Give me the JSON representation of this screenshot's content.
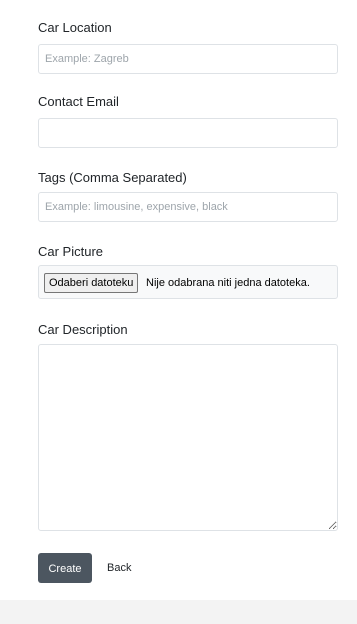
{
  "form": {
    "location": {
      "label": "Car Location",
      "value": "",
      "placeholder": "Example: Zagreb"
    },
    "email": {
      "label": "Contact Email",
      "value": "",
      "placeholder": ""
    },
    "tags": {
      "label": "Tags (Comma Separated)",
      "value": "",
      "placeholder": "Example: limousine, expensive, black"
    },
    "picture": {
      "label": "Car Picture",
      "button_label": "Odaberi datoteku",
      "status": "Nije odabrana niti jedna datoteka."
    },
    "description": {
      "label": "Car Description",
      "value": ""
    }
  },
  "actions": {
    "create_label": "Create",
    "back_label": "Back"
  },
  "colors": {
    "page_background": "#f3f3f3",
    "card_background": "#ffffff",
    "primary_button": "#4c5660",
    "input_border": "#dee2e6",
    "placeholder_text": "#9ea5ab"
  }
}
